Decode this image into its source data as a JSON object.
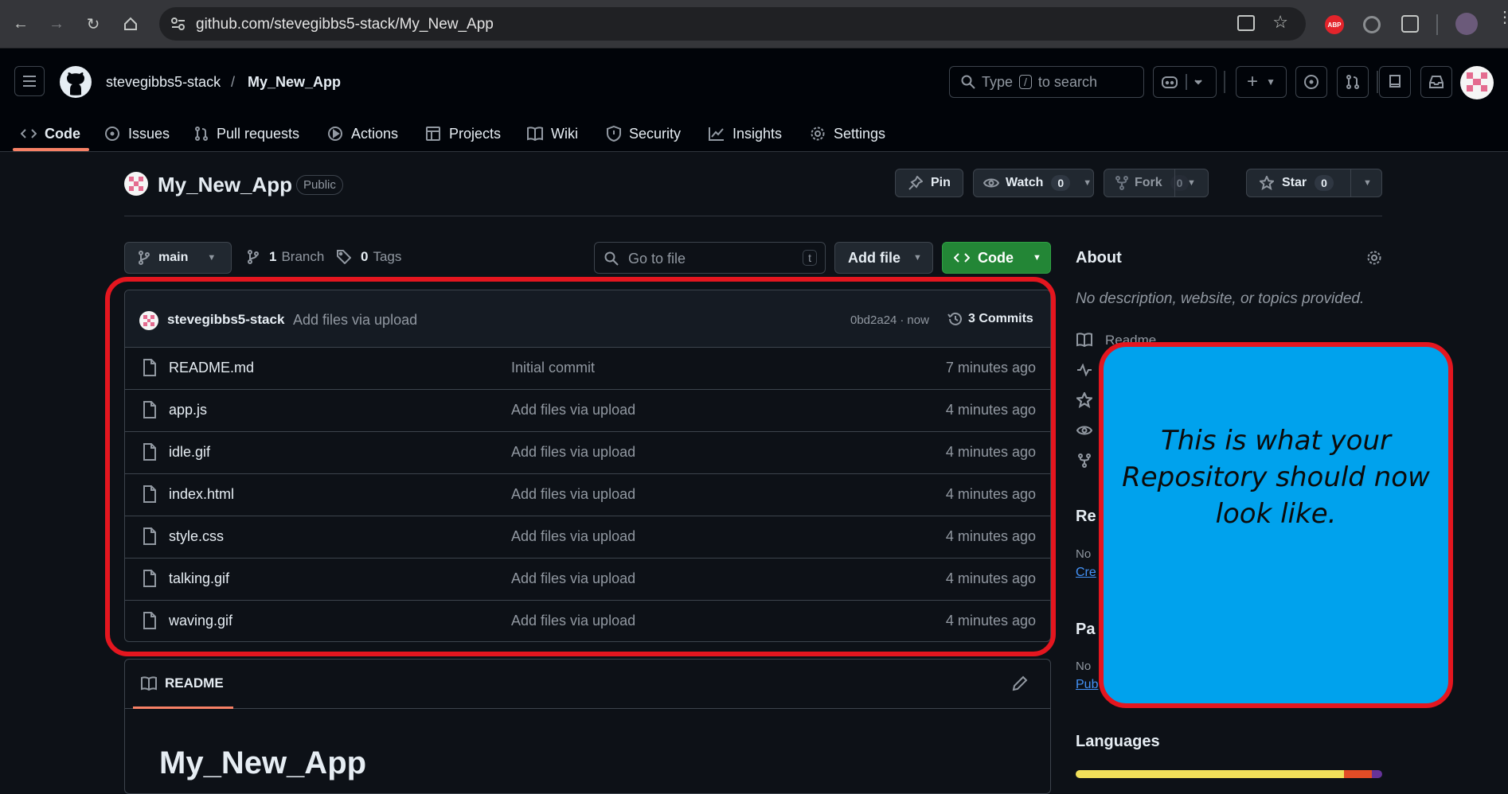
{
  "browser": {
    "url": "github.com/stevegibbs5-stack/My_New_App"
  },
  "header": {
    "owner": "stevegibbs5-stack",
    "separator": "/",
    "repo": "My_New_App",
    "search_pre": "Type",
    "search_key": "/",
    "search_post": "to search"
  },
  "tabs": [
    "Code",
    "Issues",
    "Pull requests",
    "Actions",
    "Projects",
    "Wiki",
    "Security",
    "Insights",
    "Settings"
  ],
  "repo": {
    "name": "My_New_App",
    "visibility": "Public",
    "pin_label": "Pin",
    "watch_label": "Watch",
    "watch_count": "0",
    "fork_label": "Fork",
    "fork_count": "0",
    "star_label": "Star",
    "star_count": "0"
  },
  "toolbar": {
    "branch": "main",
    "branches_count": "1",
    "branches_label": "Branch",
    "tags_count": "0",
    "tags_label": "Tags",
    "goto_placeholder": "Go to file",
    "goto_key": "t",
    "add_file": "Add file",
    "code": "Code"
  },
  "commit": {
    "author": "stevegibbs5-stack",
    "message": "Add files via upload",
    "hash": "0bd2a24",
    "dot": "·",
    "when": "now",
    "commits": "3 Commits"
  },
  "files": [
    {
      "name": "README.md",
      "message": "Initial commit",
      "time": "7 minutes ago"
    },
    {
      "name": "app.js",
      "message": "Add files via upload",
      "time": "4 minutes ago"
    },
    {
      "name": "idle.gif",
      "message": "Add files via upload",
      "time": "4 minutes ago"
    },
    {
      "name": "index.html",
      "message": "Add files via upload",
      "time": "4 minutes ago"
    },
    {
      "name": "style.css",
      "message": "Add files via upload",
      "time": "4 minutes ago"
    },
    {
      "name": "talking.gif",
      "message": "Add files via upload",
      "time": "4 minutes ago"
    },
    {
      "name": "waving.gif",
      "message": "Add files via upload",
      "time": "4 minutes ago"
    }
  ],
  "readme": {
    "tab_label": "README",
    "heading": "My_New_App"
  },
  "about": {
    "title": "About",
    "description": "No description, website, or topics provided.",
    "readme_link": "Readme",
    "releases_partial": "Re",
    "releases_no": "No",
    "releases_link": "Cre",
    "packages_partial": "Pa",
    "packages_no": "No",
    "packages_link": "Pub",
    "languages_title": "Languages",
    "languages_colors": [
      "#f1e05a",
      "#e34c26",
      "#663399"
    ]
  },
  "callout": {
    "text": "This is what your\nRepository should now\nlook like."
  }
}
